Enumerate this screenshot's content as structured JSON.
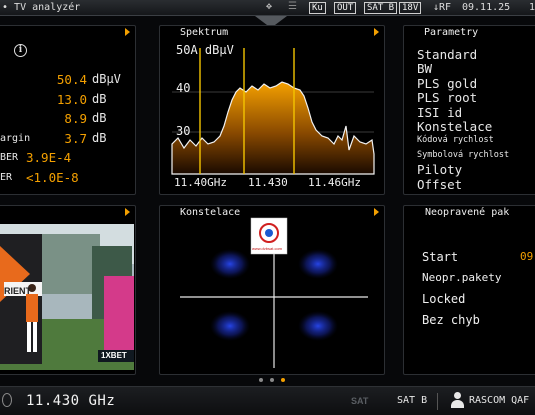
{
  "app": {
    "title": "TV analyzér"
  },
  "status_bar": {
    "band": "Ku",
    "output": "OUT",
    "sat": "SAT B",
    "sat_prefix": "SAT",
    "sat_suffix": "B",
    "voltage": "18V",
    "rf_label": "↓RF",
    "date": "09.11.25",
    "trailing": "1"
  },
  "measurements": {
    "rows": [
      {
        "label": "",
        "value": "50.4",
        "unit": "dBμV"
      },
      {
        "label": "",
        "value": "13.0",
        "unit": "dB"
      },
      {
        "label": "",
        "value": "8.9",
        "unit": "dB"
      },
      {
        "label": "argin",
        "value": "3.7",
        "unit": "dB"
      },
      {
        "label": "BER",
        "value": "3.9E-4",
        "unit": ""
      },
      {
        "label": "ER",
        "value": "<1.0E-8",
        "unit": ""
      }
    ]
  },
  "spectrum": {
    "title": "Spektrum",
    "level": "50A dBμV",
    "y_labels": [
      "40",
      "30"
    ],
    "x_labels": [
      "11.40GHz",
      "11.430",
      "11.46GHz"
    ],
    "accent": "#f4a000"
  },
  "parameters": {
    "title": "Parametry",
    "items": [
      {
        "text": "Standard",
        "size": "big"
      },
      {
        "text": "BW",
        "size": "big"
      },
      {
        "text": "PLS gold",
        "size": "big"
      },
      {
        "text": "PLS root",
        "size": "big"
      },
      {
        "text": "ISI id",
        "size": "big"
      },
      {
        "text": "Konstelace",
        "size": "big"
      },
      {
        "text": "Kódová rychlost",
        "size": "small"
      },
      {
        "text": "Symbolová rychlost",
        "size": "small"
      },
      {
        "text": "Piloty",
        "size": "big"
      },
      {
        "text": "Offset",
        "size": "big"
      }
    ]
  },
  "constellation": {
    "title": "Konstelace",
    "logo_text": "www.dvbsat.com"
  },
  "errors": {
    "title": "Neopravené pak",
    "start_label": "Start",
    "start_value": "09",
    "uncorrected_label": "Neopr.pakety",
    "locked_label": "Locked",
    "no_errors_label": "Bez chyb"
  },
  "video": {
    "banner_text": "RIENT",
    "sponsor_text": "1XBET"
  },
  "bottom": {
    "frequency": "11.430 GHz",
    "sat_label": "SAT B",
    "sat_logo": "SAT",
    "user": "RASCOM QAF"
  }
}
